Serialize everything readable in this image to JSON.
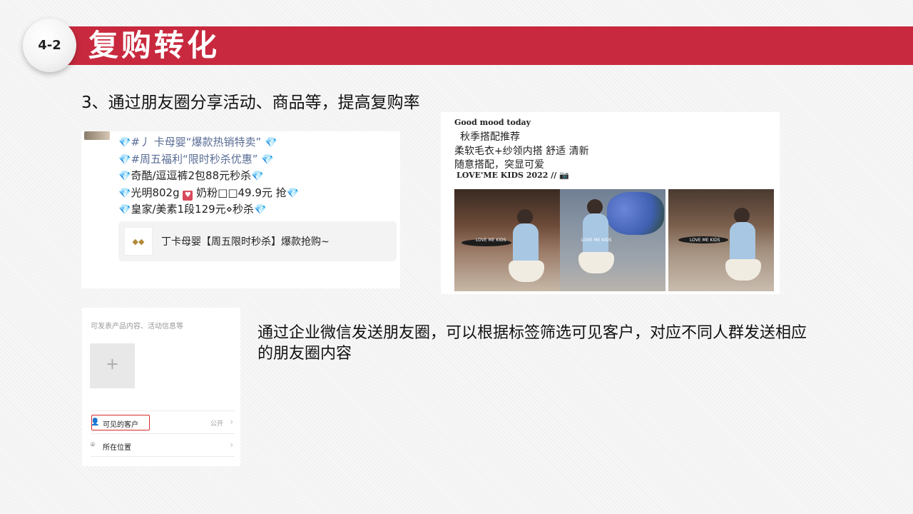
{
  "header": {
    "badge": "4-2",
    "title": "复购转化"
  },
  "subtitle": "3、通过朋友圈分享活动、商品等，提高复购率",
  "moments_post": {
    "lines": [
      {
        "pre": "#",
        "text": "丿 卡母婴“爆款热销特卖”",
        "post": ""
      },
      {
        "pre": "#",
        "text": "周五福利“限时秒杀优惠”",
        "post": ""
      },
      {
        "pre": "",
        "text": "奇酷/逗逗裤2包88元秒杀",
        "post": ""
      },
      {
        "pre": "",
        "text": "光明802g",
        "mid": "奶粉□□49.9元 抢",
        "post": ""
      },
      {
        "pre": "",
        "text": "皇家/美素1段129元⋄秒杀",
        "post": ""
      }
    ],
    "link_text": "丁卡母婴【周五限时秒杀】爆款抢购~"
  },
  "photo_post": {
    "line1": "Good mood today",
    "line2": "秋季搭配推荐",
    "line3": "柔软毛衣+纱领内搭  舒适 清新",
    "line4": "随意搭配，突显可爱",
    "brand": "LOVE'ME KIDS 2022 //"
  },
  "form": {
    "placeholder": "可发表产品内容、活动信息等",
    "add_symbol": "+",
    "visible_label": "可见的客户",
    "visible_value": "公开",
    "location_label": "所在位置",
    "chevron": "›"
  },
  "description": "通过企业微信发送朋友圈，可以根据标签筛选可见客户，对应不同人群发送相应的朋友圈内容",
  "colors": {
    "title_bar": "#c8293e",
    "highlight_box": "#d62b2b",
    "gem": "#3aa0e8"
  },
  "icons": [
    "diamond-icon",
    "camera-icon",
    "person-icon",
    "location-pin-icon",
    "chevron-right-icon",
    "plus-icon"
  ]
}
